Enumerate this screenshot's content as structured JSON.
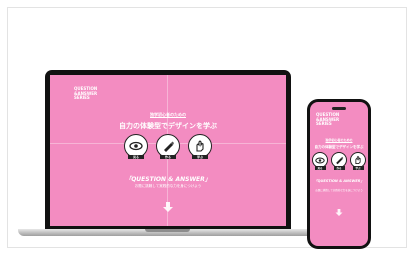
{
  "page": {
    "background_color": "#ffffff",
    "accent_color": "#f38cc1"
  },
  "laptop_site": {
    "logo_lines": [
      "QUESTION",
      "&ANSWER",
      "SERIES"
    ],
    "small_title": "独学初心者のための",
    "headline": "自力の体験型でデザインを学ぶ",
    "tagline": "「QUESTION & ANSWER」",
    "caption": "お題に挑戦して実践的な力を身につけよう",
    "icons": [
      {
        "name": "eye-icon",
        "badge": "見る"
      },
      {
        "name": "pencil-icon",
        "badge": "作る"
      },
      {
        "name": "hand-icon",
        "badge": "学ぶ"
      }
    ],
    "arrow_icon": "arrow-down-icon"
  },
  "phone_site": {
    "logo_lines": [
      "QUESTION",
      "&ANSWER",
      "SERIES"
    ],
    "small_title": "独学初心者のための",
    "headline": "自力の体験型でデザインを学ぶ",
    "tagline": "「QUESTION & ANSWER」",
    "caption": "お題に挑戦して実践的な力を身につけよう",
    "icons": [
      {
        "name": "eye-icon",
        "badge": "見る"
      },
      {
        "name": "pencil-icon",
        "badge": "作る"
      },
      {
        "name": "hand-icon",
        "badge": "学ぶ"
      }
    ],
    "arrow_icon": "arrow-down-icon"
  }
}
